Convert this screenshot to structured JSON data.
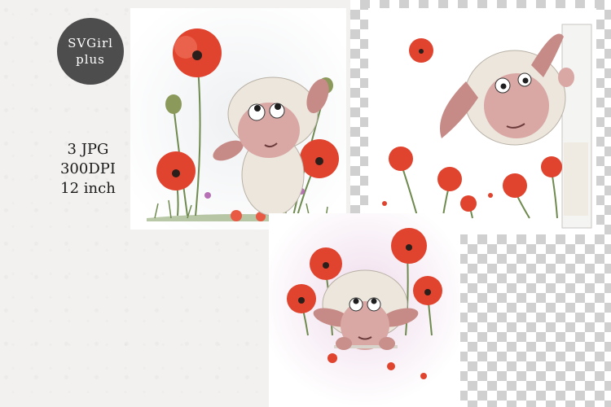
{
  "badge": {
    "line1": "SVGirl",
    "line2": "plus"
  },
  "info": {
    "line1": "3 JPG",
    "line2": "300DPI",
    "line3": "12 inch"
  },
  "colors": {
    "badge_bg": "#4d4d4d",
    "poppy": "#e0432e",
    "sheep_face": "#d9a8a5",
    "wool": "#ece6dc"
  },
  "previews": [
    {
      "subject": "sheep-among-poppies-looking-up"
    },
    {
      "subject": "sheep-peeking-from-wall-with-poppies"
    },
    {
      "subject": "sheep-peeking-over-ledge-with-poppies"
    }
  ]
}
